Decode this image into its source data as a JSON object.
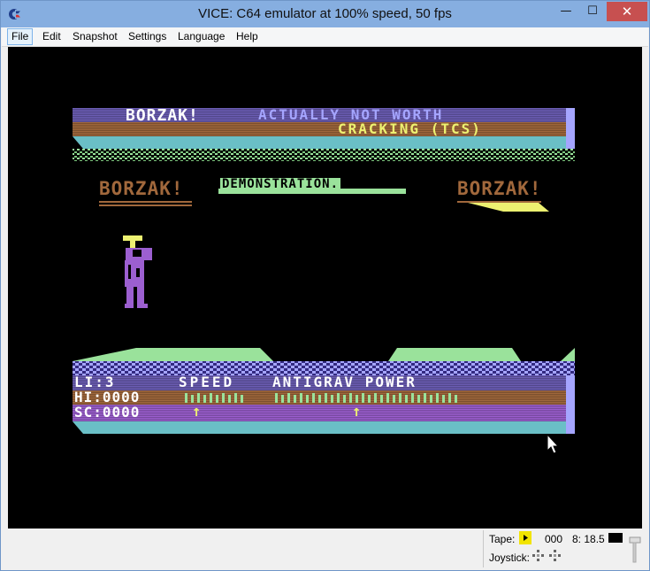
{
  "window": {
    "title": "VICE: C64 emulator at 100% speed, 50 fps",
    "icon": "commodore-logo-icon",
    "controls": {
      "minimize": "—",
      "maximize": "☐",
      "close": "✕"
    }
  },
  "menubar": {
    "items": [
      {
        "label": "File"
      },
      {
        "label": "Edit"
      },
      {
        "label": "Snapshot"
      },
      {
        "label": "Settings"
      },
      {
        "label": "Language"
      },
      {
        "label": "Help"
      }
    ]
  },
  "game": {
    "banner_title": "BORZAK!",
    "banner_line1": "ACTUALLY NOT WORTH",
    "banner_line2": "CRACKING (TCS)",
    "logo_left": "BORZAK!",
    "demo_label": "DEMONSTRATION.",
    "logo_right": "BORZAK!",
    "hud_lives": "LI:3",
    "hud_speed": "SPEED",
    "hud_antigrav": "ANTIGRAV POWER",
    "hud_hi": "HI:0000",
    "hud_score": "SC:0000",
    "hud_arrow": "↑",
    "colors": {
      "purple": "#6c5eb5",
      "brown": "#a1683c",
      "light_purple": "#9c5fd0",
      "green": "#9ae29b",
      "yellow": "#edf171",
      "cyan": "#6abfc6",
      "light_blue": "#a5a5ff",
      "white": "#ffffff"
    }
  },
  "status": {
    "tape_label": "Tape:",
    "tape_counter": "000",
    "drive_label": "8: 18.5",
    "joystick_label": "Joystick:"
  }
}
